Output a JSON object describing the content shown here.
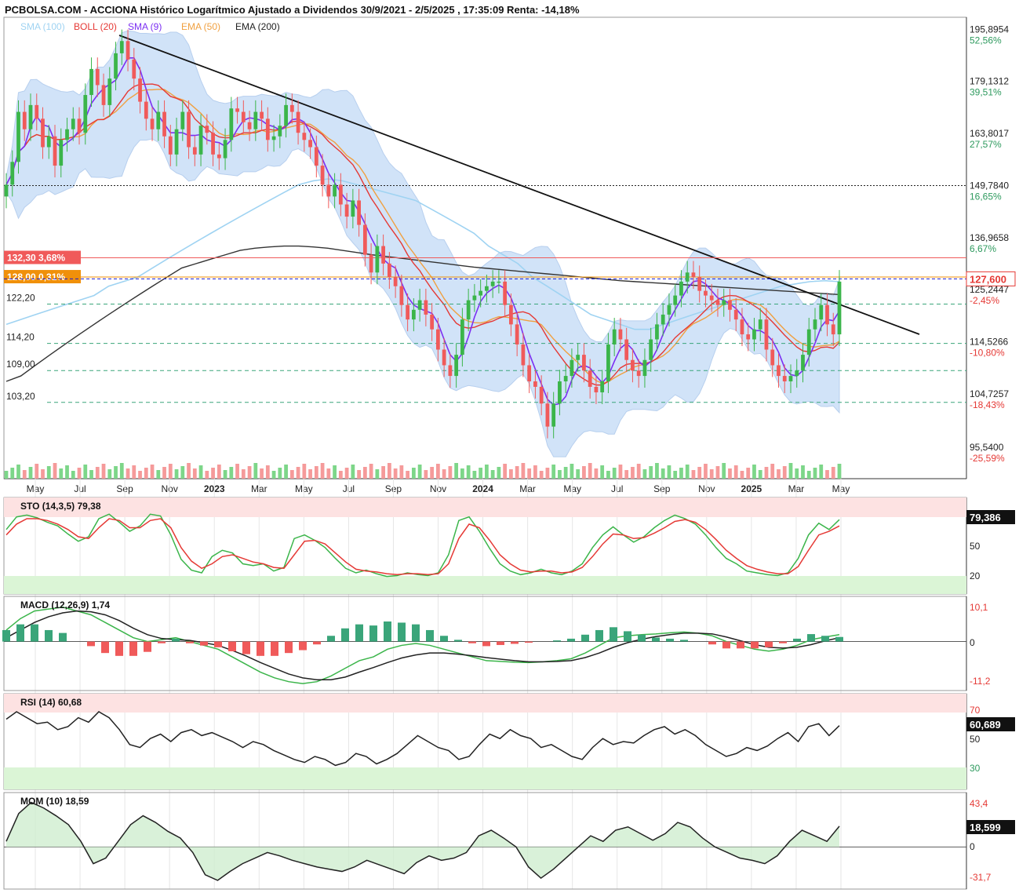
{
  "header": {
    "title": "PCBOLSA.COM - ACCIONA Histórico Logarítmico Ajustado a Dividendos 30/9/2021 - 2/5/2025 , 17:35:09 Renta: -14,18%"
  },
  "legend": [
    {
      "label": "SMA (100)",
      "color": "#9fd3f2"
    },
    {
      "label": "BOLL (20)",
      "color": "#e53935"
    },
    {
      "label": "SMA (9)",
      "color": "#7b2ff2"
    },
    {
      "label": "EMA (50)",
      "color": "#f0a040"
    },
    {
      "label": "EMA (200)",
      "color": "#222222"
    }
  ],
  "colors": {
    "up": "#3bb54a",
    "down": "#f05a5a",
    "band": "#c9def7",
    "trendline": "#111111",
    "current": "#e53935",
    "grid_dashed": "#3aa57a"
  },
  "chart_data": [
    {
      "type": "candlestick",
      "title": "ACCIONA",
      "x_ticks": [
        "May",
        "Jul",
        "Sep",
        "Nov",
        "2023",
        "Mar",
        "May",
        "Jul",
        "Sep",
        "Nov",
        "2024",
        "Mar",
        "May",
        "Jul",
        "Sep",
        "Nov",
        "2025",
        "Mar",
        "May"
      ],
      "y_scale": "log",
      "ylim": [
        93,
        200
      ],
      "right_axis": [
        {
          "price": "195,8954",
          "pct": "52,56%"
        },
        {
          "price": "179,1312",
          "pct": "39,51%"
        },
        {
          "price": "163,8017",
          "pct": "27,57%"
        },
        {
          "price": "149,7840",
          "pct": "16,65%"
        },
        {
          "price": "136,9658",
          "pct": "6,67%"
        },
        {
          "price": "125,2447",
          "pct": "-2,45%"
        },
        {
          "price": "114,5266",
          "pct": "-10,80%"
        },
        {
          "price": "104,7257",
          "pct": "-18,43%"
        },
        {
          "price": "95,5400",
          "pct": "-25,59%"
        }
      ],
      "current_price": "127,600",
      "price_levels": [
        {
          "label": "132,30  3,68%",
          "value": 132.3,
          "color": "#f05a5a"
        },
        {
          "label": "128,00  0,31%",
          "value": 128.0,
          "color": "#f0900a"
        },
        {
          "label": "122,20",
          "value": 122.2
        },
        {
          "label": "114,20",
          "value": 114.2
        },
        {
          "label": "109,00",
          "value": 109.0
        },
        {
          "label": "103,20",
          "value": 103.2
        }
      ],
      "horizontal_dotted": 149.78,
      "closes": [
        150,
        156,
        170,
        165,
        172,
        168,
        160,
        163,
        155,
        162,
        165,
        168,
        164,
        175,
        183,
        178,
        172,
        180,
        188,
        192,
        186,
        180,
        173,
        168,
        165,
        170,
        163,
        158,
        165,
        170,
        160,
        158,
        166,
        164,
        158,
        157,
        162,
        171,
        170,
        167,
        165,
        170,
        168,
        162,
        163,
        166,
        172,
        170,
        164,
        162,
        160,
        155,
        150,
        147,
        150,
        145,
        142,
        146,
        140,
        133,
        129,
        135,
        131,
        128,
        126,
        122,
        119,
        121,
        123,
        120,
        117,
        113,
        110,
        108,
        112,
        119,
        123,
        124,
        125,
        126,
        127,
        127,
        122,
        118,
        114,
        110,
        107,
        106,
        103,
        99,
        103,
        107,
        108,
        111,
        112,
        109,
        106,
        105,
        107,
        114,
        117,
        115,
        111,
        109,
        108,
        111,
        115,
        118,
        120,
        122,
        124,
        127,
        129,
        128,
        125,
        124,
        123,
        122,
        123,
        121,
        119,
        116,
        115,
        117,
        119,
        113,
        110,
        108,
        107,
        108,
        109,
        112,
        117,
        119,
        122,
        118,
        116,
        127
      ],
      "sma100": [
        118,
        119,
        120,
        121,
        122,
        123,
        124,
        126,
        127,
        128,
        130,
        132,
        134,
        136,
        138,
        140,
        142,
        144,
        146,
        148,
        150,
        151,
        151.5,
        151,
        150,
        149,
        148,
        147,
        146,
        144,
        142,
        140,
        138,
        135,
        133,
        131,
        128,
        126,
        124,
        122,
        120,
        119,
        118,
        117,
        117,
        118,
        119,
        120,
        121,
        122,
        123,
        124,
        125,
        126,
        126.5,
        127,
        127.2,
        127
      ],
      "ema200": [
        107,
        108,
        110,
        112,
        114,
        116,
        118,
        120,
        122,
        124,
        126,
        128,
        130,
        131,
        132,
        133,
        134,
        134.5,
        134.8,
        135,
        135,
        134.8,
        134.5,
        134,
        133.5,
        133,
        132.6,
        132.2,
        131.8,
        131.4,
        131,
        130.6,
        130.2,
        129.9,
        129.6,
        129.3,
        129,
        128.7,
        128.4,
        128.1,
        127.8,
        127.5,
        127.2,
        127,
        126.8,
        126.6,
        126.4,
        126.2,
        126,
        125.8,
        125.6,
        125.4,
        125.2,
        125,
        124.8,
        124.6,
        124.4,
        124.2
      ]
    },
    {
      "type": "line",
      "title": "STO (14,3,5)  79,38",
      "right_label": "79,386",
      "levels": [
        "20",
        "50"
      ],
      "series": [
        {
          "values": [
            68,
            82,
            84,
            81,
            76,
            72,
            63,
            55,
            60,
            80,
            85,
            76,
            66,
            72,
            85,
            83,
            62,
            35,
            23,
            20,
            38,
            45,
            42,
            30,
            28,
            30,
            22,
            26,
            58,
            62,
            56,
            48,
            36,
            25,
            20,
            23,
            19,
            16,
            17,
            20,
            18,
            17,
            20,
            40,
            78,
            82,
            66,
            47,
            30,
            22,
            18,
            20,
            24,
            20,
            18,
            22,
            30,
            48,
            62,
            71,
            62,
            54,
            60,
            70,
            78,
            84,
            80,
            74,
            62,
            48,
            36,
            30,
            22,
            20,
            18,
            17,
            20,
            36,
            62,
            75,
            68,
            79
          ]
        },
        {
          "values": [
            62,
            74,
            80,
            80,
            78,
            74,
            68,
            60,
            58,
            70,
            80,
            78,
            70,
            70,
            78,
            80,
            70,
            48,
            33,
            25,
            30,
            38,
            40,
            36,
            32,
            30,
            26,
            25,
            40,
            55,
            56,
            52,
            42,
            32,
            24,
            22,
            21,
            19,
            18,
            19,
            19,
            18,
            19,
            30,
            58,
            74,
            70,
            56,
            40,
            30,
            23,
            21,
            22,
            22,
            20,
            21,
            26,
            38,
            52,
            63,
            62,
            58,
            59,
            64,
            70,
            77,
            79,
            76,
            68,
            57,
            45,
            36,
            28,
            24,
            21,
            19,
            19,
            27,
            45,
            62,
            66,
            72
          ]
        }
      ]
    },
    {
      "type": "line",
      "title": "MACD (12,26,9)  1,74",
      "y_ticks": [
        "10,1",
        "0",
        "-11,2"
      ],
      "series": [
        {
          "values": [
            3,
            6,
            8,
            8.5,
            9,
            8,
            7,
            5,
            3,
            1,
            0,
            0.5,
            1,
            0,
            -1,
            -2,
            -4,
            -6,
            -8,
            -9.5,
            -10.5,
            -11,
            -10.5,
            -9,
            -7,
            -5,
            -4,
            -2,
            -1,
            -0.5,
            -1,
            -2,
            -3,
            -4,
            -5,
            -5.2,
            -5.4,
            -5.5,
            -5.3,
            -5,
            -4.5,
            -3,
            -1,
            1,
            1.5,
            1.8,
            2,
            2.3,
            2.5,
            2.2,
            1.5,
            0,
            -1,
            -2,
            -2.5,
            -2,
            -1,
            0.5,
            1.2,
            1.8
          ]
        },
        {
          "values": [
            1,
            3,
            5,
            6.5,
            7.5,
            8,
            7.8,
            7,
            5.5,
            3.5,
            1.8,
            0.8,
            0.5,
            0.3,
            -0.3,
            -1,
            -2.3,
            -3.8,
            -5.5,
            -7,
            -8.5,
            -9.5,
            -10,
            -10,
            -9.3,
            -8,
            -6.8,
            -5.5,
            -4.3,
            -3.5,
            -3,
            -3,
            -3.3,
            -3.7,
            -4.2,
            -4.6,
            -5,
            -5.3,
            -5.3,
            -5.2,
            -5,
            -4.2,
            -3,
            -1.5,
            -0.3,
            0.6,
            1.3,
            1.8,
            2.2,
            2.2,
            2,
            1.2,
            0.2,
            -0.8,
            -1.5,
            -1.7,
            -1.5,
            -0.8,
            0.2,
            1
          ]
        }
      ]
    },
    {
      "type": "line",
      "title": "RSI (14)  60,68",
      "right_label": "60,689",
      "levels": [
        "70",
        "50",
        "30"
      ],
      "series": [
        {
          "values": [
            65,
            70,
            66,
            62,
            63,
            58,
            60,
            66,
            63,
            70,
            66,
            58,
            48,
            46,
            52,
            55,
            50,
            56,
            58,
            54,
            56,
            53,
            50,
            46,
            50,
            48,
            44,
            41,
            38,
            36,
            40,
            38,
            34,
            36,
            42,
            40,
            35,
            38,
            42,
            48,
            54,
            50,
            46,
            44,
            38,
            40,
            48,
            55,
            52,
            58,
            54,
            52,
            46,
            48,
            44,
            40,
            38,
            46,
            52,
            48,
            50,
            49,
            54,
            58,
            60,
            55,
            58,
            54,
            48,
            44,
            40,
            42,
            46,
            44,
            47,
            52,
            56,
            50,
            60,
            62,
            54,
            60.7
          ]
        }
      ]
    },
    {
      "type": "line",
      "title": "MOM (10)  18,59",
      "y_ticks": [
        "43,4",
        "0",
        "-31,7"
      ],
      "right_label": "18,599",
      "series": [
        {
          "values": [
            5,
            30,
            40,
            35,
            28,
            20,
            5,
            -15,
            -10,
            5,
            20,
            28,
            22,
            14,
            8,
            -5,
            -25,
            -30,
            -22,
            -15,
            -10,
            -5,
            -8,
            -12,
            -15,
            -18,
            -20,
            -22,
            -18,
            -12,
            -16,
            -20,
            -24,
            -14,
            -8,
            -12,
            -10,
            -5,
            10,
            15,
            8,
            0,
            -18,
            -28,
            -20,
            -10,
            0,
            10,
            5,
            15,
            18,
            12,
            6,
            12,
            22,
            18,
            8,
            0,
            -5,
            -10,
            -12,
            -15,
            -8,
            5,
            15,
            10,
            5,
            18.6
          ]
        }
      ]
    }
  ]
}
